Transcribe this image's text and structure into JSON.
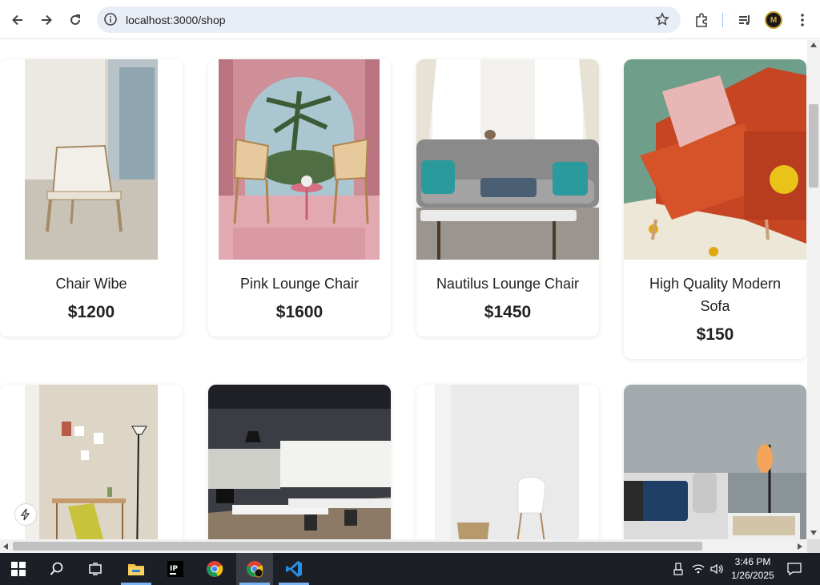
{
  "browser": {
    "url": "localhost:3000/shop",
    "icons": [
      "back-arrow-icon",
      "forward-arrow-icon",
      "reload-icon",
      "site-info-icon",
      "bookmark-star-icon",
      "extensions-icon",
      "media-queue-icon",
      "profile-avatar",
      "more-menu-icon"
    ]
  },
  "products": [
    {
      "name": "Chair Wibe",
      "price": "$1200",
      "image": "white woven chair by window"
    },
    {
      "name": "Pink Lounge Chair",
      "price": "$1600",
      "image": "pink room with two chairs and palm"
    },
    {
      "name": "Nautilus Lounge Chair",
      "price": "$1450",
      "image": "grey tufted sofa with teal pillows"
    },
    {
      "name": "High Quality Modern Sofa",
      "price": "$150",
      "image": "orange sofa with pink pillow"
    },
    {
      "name": "",
      "price": "",
      "image": "yellow chair with desk and lamp"
    },
    {
      "name": "",
      "price": "",
      "image": "modern office interior"
    },
    {
      "name": "",
      "price": "",
      "image": "white chair and basket"
    },
    {
      "name": "",
      "price": "",
      "image": "bedroom with lamp and nightstand"
    }
  ],
  "taskbar": {
    "time": "3:46 PM",
    "date": "1/26/2025",
    "apps": [
      "start-icon",
      "search-icon",
      "task-view-icon",
      "file-explorer-icon",
      "intellij-icon",
      "chrome-icon",
      "chrome-profile-icon",
      "vscode-icon"
    ]
  },
  "colors": {
    "accent": "#7ab4f5",
    "omnibox": "#e9eef6",
    "taskbar": "#1c1f26"
  }
}
